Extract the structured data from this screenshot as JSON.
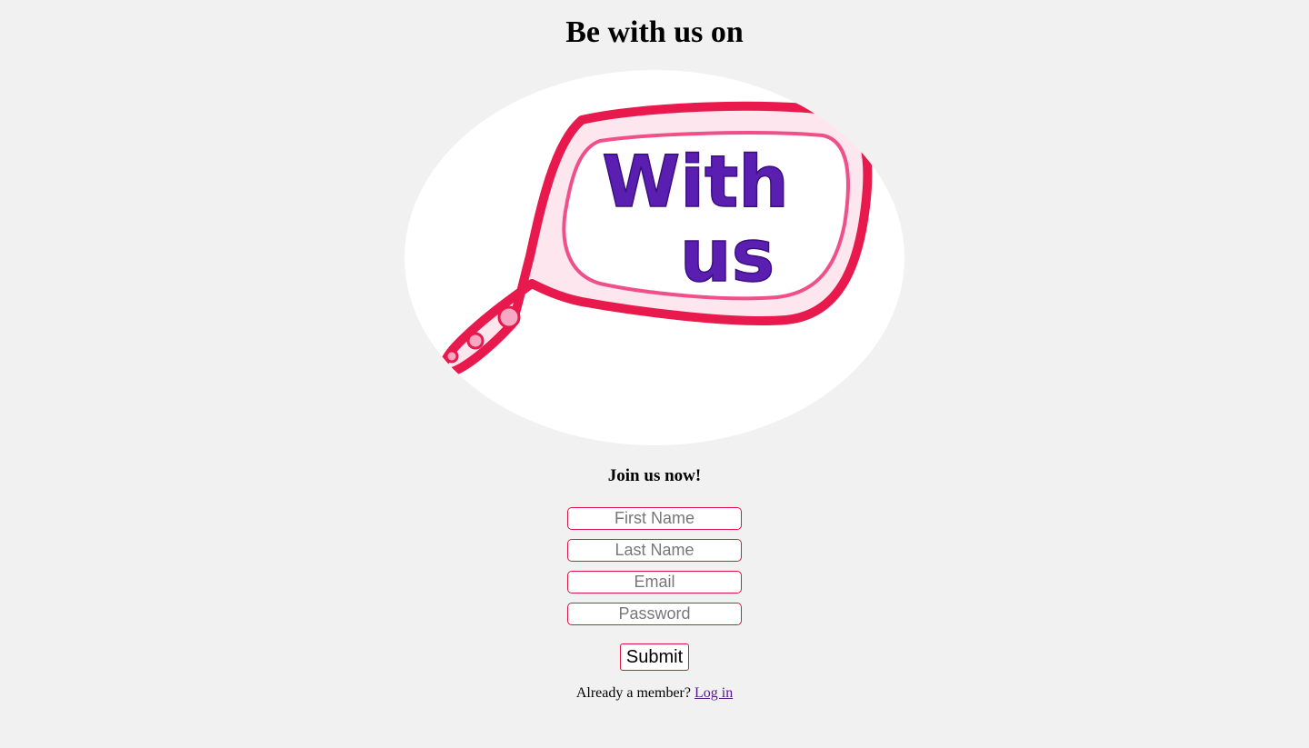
{
  "header": {
    "title": "Be with us on"
  },
  "logo": {
    "text_line1": "With",
    "text_line2": "us",
    "icon": "speech-bubble-logo",
    "colors": {
      "bubble": "#e8194c",
      "text": "#5a1fb0"
    }
  },
  "signup": {
    "heading": "Join us now!",
    "fields": {
      "first_name_placeholder": "First Name",
      "last_name_placeholder": "Last Name",
      "email_placeholder": "Email",
      "password_placeholder": "Password"
    },
    "submit_label": "Submit",
    "member_prompt": "Already a member?",
    "login_link": "Log in"
  },
  "colors": {
    "background": "#f1f1f1",
    "accent_border": "#dd1744",
    "link": "#551a8b"
  }
}
